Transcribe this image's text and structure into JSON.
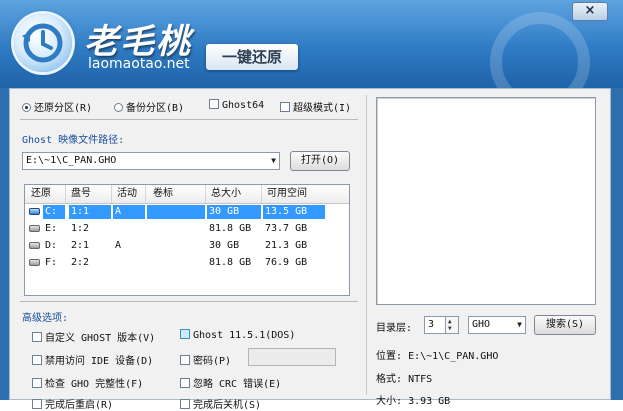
{
  "window": {
    "brand": "老毛桃",
    "url": "laomaotao.net",
    "tagline": "一键还原",
    "close": "×"
  },
  "modes": [
    {
      "label": "还原分区(R)",
      "type": "radio",
      "checked": true
    },
    {
      "label": "备份分区(B)",
      "type": "radio",
      "checked": false
    },
    {
      "label": "Ghost64",
      "type": "checkbox",
      "checked": false
    },
    {
      "label": "超级模式(I)",
      "type": "checkbox",
      "checked": false
    }
  ],
  "image_path": {
    "label": "Ghost 映像文件路径:",
    "value": "E:\\~1\\C_PAN.GHO",
    "open_button": "打开(O)"
  },
  "table": {
    "columns": [
      "还原",
      "盘号",
      "活动",
      "卷标",
      "总大小",
      "可用空间"
    ],
    "rows": [
      {
        "drive": "C:",
        "num": "1:1",
        "active": "A",
        "label": "",
        "total": "30 GB",
        "free": "13.5 GB",
        "selected": true
      },
      {
        "drive": "E:",
        "num": "1:2",
        "active": "",
        "label": "",
        "total": "81.8 GB",
        "free": "73.7 GB",
        "selected": false
      },
      {
        "drive": "D:",
        "num": "2:1",
        "active": "A",
        "label": "",
        "total": "30 GB",
        "free": "21.3 GB",
        "selected": false
      },
      {
        "drive": "F:",
        "num": "2:2",
        "active": "",
        "label": "",
        "total": "81.8 GB",
        "free": "76.9 GB",
        "selected": false
      }
    ]
  },
  "advanced": {
    "title": "高级选项:",
    "options": [
      {
        "label": "自定义 GHOST 版本(V)",
        "checked": false,
        "highlight": false
      },
      {
        "label": "Ghost 11.5.1(DOS)",
        "checked": false,
        "highlight": true
      },
      {
        "label": "禁用访问 IDE 设备(D)",
        "checked": false,
        "highlight": false
      },
      {
        "label": "密码(P)",
        "checked": false,
        "highlight": false
      },
      {
        "label": "检查 GHO 完整性(F)",
        "checked": false,
        "highlight": false
      },
      {
        "label": "忽略 CRC 错误(E)",
        "checked": false,
        "highlight": false
      },
      {
        "label": "完成后重启(R)",
        "checked": false,
        "highlight": false
      },
      {
        "label": "完成后关机(S)",
        "checked": false,
        "highlight": false
      }
    ]
  },
  "right": {
    "dir_level_label": "目录层:",
    "dir_level_value": "3",
    "filter_value": "GHO",
    "search_button": "搜索(S)",
    "location_label": "位置:",
    "location_value": "E:\\~1\\C_PAN.GHO",
    "format_label": "格式:",
    "format_value": "NTFS",
    "size_label": "大小:",
    "size_value": "3.93 GB"
  }
}
